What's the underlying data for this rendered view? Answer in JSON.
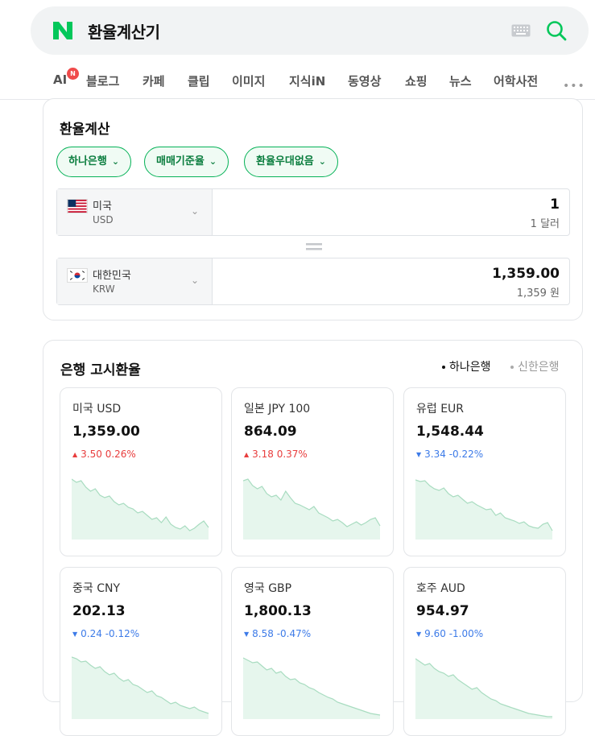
{
  "search": {
    "query": "환율계산기",
    "logo_letter": "N"
  },
  "tabs": [
    {
      "label": "AI",
      "badge": "N"
    },
    {
      "label": "블로그"
    },
    {
      "label": "카페"
    },
    {
      "label": "클립"
    },
    {
      "label": "이미지"
    },
    {
      "label": "지식iN"
    },
    {
      "label": "동영상"
    },
    {
      "label": "쇼핑"
    },
    {
      "label": "뉴스"
    },
    {
      "label": "어학사전"
    }
  ],
  "more_label": "•••",
  "calculator": {
    "title": "환율계산",
    "filters": [
      "하나은행",
      "매매기준율",
      "환율우대없음"
    ],
    "from": {
      "name": "미국",
      "code": "USD",
      "value": "1",
      "sub": "1 달러"
    },
    "to": {
      "name": "대한민국",
      "code": "KRW",
      "value": "1,359.00",
      "sub": "1,359 원"
    }
  },
  "rates": {
    "title": "은행 고시환율",
    "banks": [
      {
        "label": "하나은행",
        "active": true
      },
      {
        "label": "신한은행",
        "active": false
      }
    ],
    "tiles": [
      {
        "name": "미국 USD",
        "value": "1,359.00",
        "direction": "up",
        "change": "3.50",
        "percent": "0.26%"
      },
      {
        "name": "일본 JPY 100",
        "value": "864.09",
        "direction": "up",
        "change": "3.18",
        "percent": "0.37%"
      },
      {
        "name": "유럽 EUR",
        "value": "1,548.44",
        "direction": "down",
        "change": "3.34",
        "percent": "-0.22%"
      },
      {
        "name": "중국 CNY",
        "value": "202.13",
        "direction": "down",
        "change": "0.24",
        "percent": "-0.12%"
      },
      {
        "name": "영국 GBP",
        "value": "1,800.13",
        "direction": "down",
        "change": "8.58",
        "percent": "-0.47%"
      },
      {
        "name": "호주 AUD",
        "value": "954.97",
        "direction": "down",
        "change": "9.60",
        "percent": "-1.00%"
      }
    ]
  },
  "colors": {
    "brand_green": "#03c75a",
    "up_red": "#e83d3d",
    "down_blue": "#3d7be8",
    "spark_green": "#a8dcc0"
  }
}
